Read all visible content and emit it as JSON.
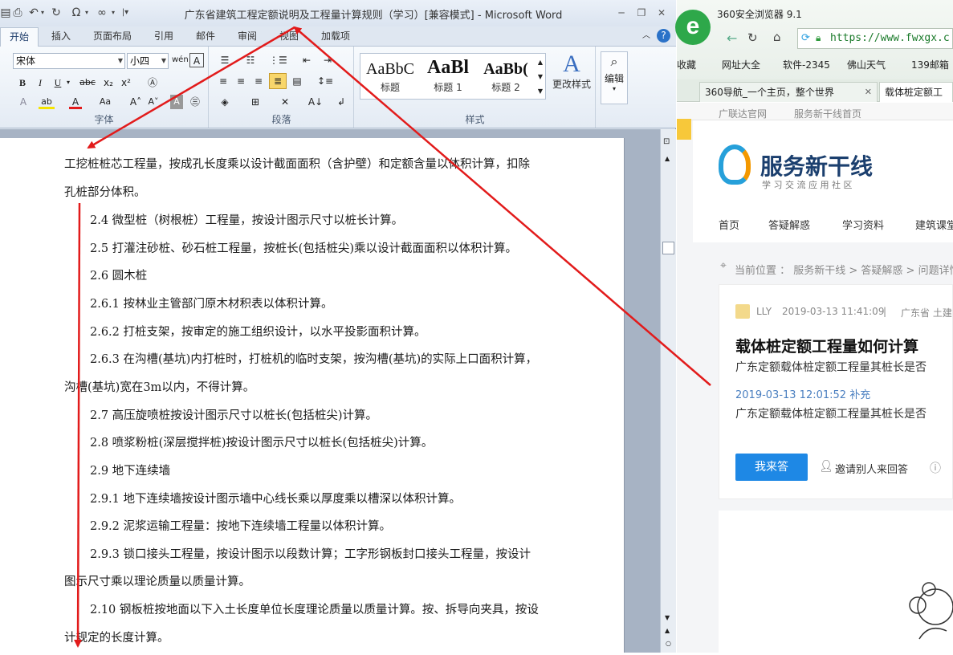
{
  "word": {
    "title": "广东省建筑工程定额说明及工程量计算规则（学习）[兼容模式] - Microsoft Word",
    "tabs": [
      "开始",
      "插入",
      "页面布局",
      "引用",
      "邮件",
      "审阅",
      "视图",
      "加载项"
    ],
    "font_name": "宋体",
    "font_size": "小四",
    "groups": {
      "font": "字体",
      "paragraph": "段落",
      "styles": "样式"
    },
    "styles": [
      {
        "sample": "AaBbC",
        "name": "标题"
      },
      {
        "sample": "AaBl",
        "name": "标题 1"
      },
      {
        "sample": "AaBb(",
        "name": "标题 2"
      }
    ],
    "change_styles": "更改样式",
    "edit": "编辑",
    "doc_lines": [
      "工挖桩桩芯工程量，按成孔长度乘以设计截面面积（含护壁）和定额含量以体积计算，扣除",
      "孔桩部分体积。",
      "2.4  微型桩（树根桩）工程量，按设计图示尺寸以桩长计算。",
      "2.5 打灌注砂桩、砂石桩工程量，按桩长(包括桩尖)乘以设计截面面积以体积计算。",
      "2.6 圆木桩",
      "2.6.1  按林业主管部门原木材积表以体积计算。",
      "2.6.2  打桩支架，按审定的施工组织设计，以水平投影面积计算。",
      "2.6.3  在沟槽(基坑)内打桩时，打桩机的临时支架，按沟槽(基坑)的实际上口面积计算，",
      "沟槽(基坑)宽在3m以内，不得计算。",
      "2.7   高压旋喷桩按设计图示尺寸以桩长(包括桩尖)计算。",
      "2.8   喷浆粉桩(深层搅拌桩)按设计图示尺寸以桩长(包括桩尖)计算。",
      "2.9   地下连续墙",
      "2.9.1 地下连续墙按设计图示墙中心线长乘以厚度乘以槽深以体积计算。",
      "2.9.2 泥浆运输工程量：按地下连续墙工程量以体积计算。",
      "2.9.3 锁口接头工程量，按设计图示以段数计算；工字形钢板封口接头工程量，按设计",
      "图示尺寸乘以理论质量以质量计算。",
      "2.10 钢板桩按地面以下入土长度单位长度理论质量以质量计算。按、拆导向夹具，按设",
      "计规定的长度计算。"
    ]
  },
  "browser": {
    "title": "360安全浏览器 9.1",
    "url": "https://www.fwxgx.c",
    "bookmarks": [
      "收藏",
      "网址大全",
      "软件-2345",
      "佛山天气",
      "139邮箱"
    ],
    "tabs": [
      "360导航_一个主页，整个世界",
      "载体桩定额工"
    ],
    "site_links": [
      "广联达官网",
      "服务新干线首页"
    ],
    "logo_title": "服务新干线",
    "logo_sub": "学 习 交 流 应 用 社 区",
    "nav": [
      "首页",
      "答疑解惑",
      "学习资料",
      "建筑课堂"
    ],
    "breadcrumb": "当前位置 ： 服务新干线 > 答疑解惑 > 问题详情",
    "user": "LLY",
    "post_time": "2019-03-13 11:41:09",
    "region": "广东省  土建",
    "question_title": "载体桩定额工程量如何计算",
    "question_body": "广东定额载体桩定额工程量其桩长是否",
    "supplement_time": "2019-03-13 12:01:52 补充",
    "supplement_body": "广东定额载体桩定额工程量其桩长是否",
    "answer_btn": "我来答",
    "invite": "邀请别人来回答"
  },
  "colors": {
    "arrow": "#e21b1b",
    "accent": "#1e88e5",
    "logo": "#26a0da"
  }
}
